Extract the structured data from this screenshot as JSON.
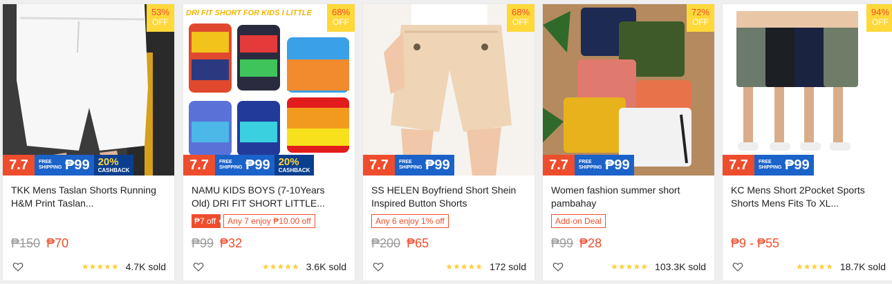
{
  "products": [
    {
      "discount": "53%",
      "off_label": "OFF",
      "banner_text": "",
      "promo": {
        "sale": "7.7",
        "shipping_label": "FREE SHIPPING",
        "shipping_amount": "₱99",
        "cashback": "20%",
        "cashback_label": "CASHBACK"
      },
      "title": "TKK Mens Taslan Shorts Running H&M Print Taslan...",
      "tags": [],
      "price_old": "₱150",
      "price": "₱70",
      "rating_stars": "★★★★★",
      "sold": "4.7K sold"
    },
    {
      "discount": "68%",
      "off_label": "OFF",
      "banner_text": "DRI FIT SHORT FOR KIDS I LITTLE",
      "promo": {
        "sale": "7.7",
        "shipping_label": "FREE SHIPPING",
        "shipping_amount": "₱99",
        "cashback": "20%",
        "cashback_label": "CASHBACK"
      },
      "title": "NAMU KIDS BOYS (7-10Years Old) DRI FIT SHORT LITTLE...",
      "tags": [
        {
          "style": "solid",
          "text": "₱7 off"
        },
        {
          "style": "outline",
          "text": "Any 7 enjoy ₱10.00 off"
        }
      ],
      "price_old": "₱99",
      "price": "₱32",
      "rating_stars": "★★★★★",
      "sold": "3.6K sold"
    },
    {
      "discount": "68%",
      "off_label": "OFF",
      "banner_text": "",
      "promo": {
        "sale": "7.7",
        "shipping_label": "FREE SHIPPING",
        "shipping_amount": "₱99",
        "cashback": "",
        "cashback_label": ""
      },
      "title": "SS HELEN Boyfriend Short Shein Inspired Button Shorts",
      "tags": [
        {
          "style": "outline",
          "text": "Any 6 enjoy 1% off"
        }
      ],
      "price_old": "₱200",
      "price": "₱65",
      "rating_stars": "★★★★★",
      "sold": "172 sold"
    },
    {
      "discount": "72%",
      "off_label": "OFF",
      "banner_text": "",
      "promo": {
        "sale": "7.7",
        "shipping_label": "FREE SHIPPING",
        "shipping_amount": "₱99",
        "cashback": "",
        "cashback_label": ""
      },
      "title": "Women fashion summer short pambahay",
      "tags": [
        {
          "style": "outline",
          "text": "Add-on Deal"
        }
      ],
      "price_old": "₱99",
      "price": "₱28",
      "rating_stars": "★★★★★",
      "sold": "103.3K sold"
    },
    {
      "discount": "94%",
      "off_label": "OFF",
      "banner_text": "",
      "promo": {
        "sale": "7.7",
        "shipping_label": "FREE SHIPPING",
        "shipping_amount": "₱99",
        "cashback": "",
        "cashback_label": ""
      },
      "title": "KC Mens Short 2Pocket Sports Shorts Mens Fits To XL...",
      "tags": [],
      "price_old": "",
      "price": "₱9 - ₱55",
      "rating_stars": "★★★★★",
      "sold": "18.7K sold"
    }
  ],
  "colors": {
    "accent": "#ee4d2d",
    "discount_bg": "#ffd839",
    "shipping_bg": "#1b62c9",
    "star": "#ffce3d"
  },
  "icons": {
    "wishlist": "heart-outline-icon",
    "rating": "star-icon"
  }
}
